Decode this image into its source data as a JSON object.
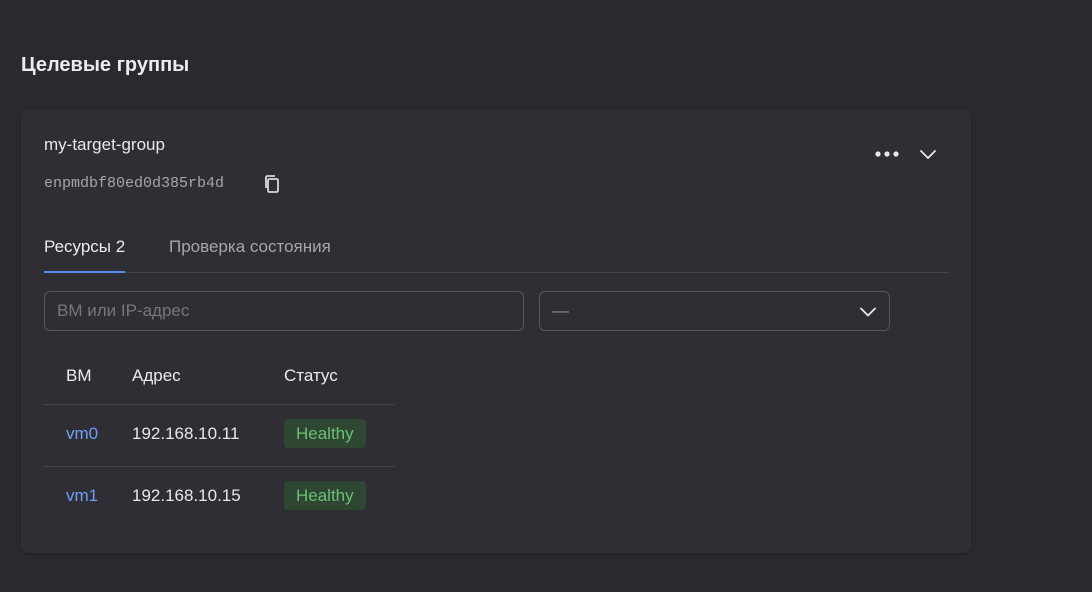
{
  "section": {
    "title": "Целевые группы"
  },
  "group": {
    "name": "my-target-group",
    "id": "enpmdbf80ed0d385rb4d"
  },
  "tabs": [
    {
      "label": "Ресурсы 2",
      "active": true
    },
    {
      "label": "Проверка состояния",
      "active": false
    }
  ],
  "filters": {
    "search_placeholder": "ВМ или IP-адрес",
    "search_value": "",
    "select_value": "—"
  },
  "table": {
    "columns": [
      "ВМ",
      "Адрес",
      "Статус"
    ],
    "rows": [
      {
        "vm": "vm0",
        "address": "192.168.10.11",
        "status": "Healthy"
      },
      {
        "vm": "vm1",
        "address": "192.168.10.15",
        "status": "Healthy"
      }
    ]
  },
  "icons": {
    "copy": "copy-icon",
    "more": "more-horizontal-icon",
    "expand": "chevron-down-icon",
    "select_chevron": "chevron-down-icon"
  },
  "colors": {
    "accent": "#5a8cf5",
    "link": "#6f9ef7",
    "healthy_text": "#68c174",
    "healthy_bg": "#2f4632"
  }
}
